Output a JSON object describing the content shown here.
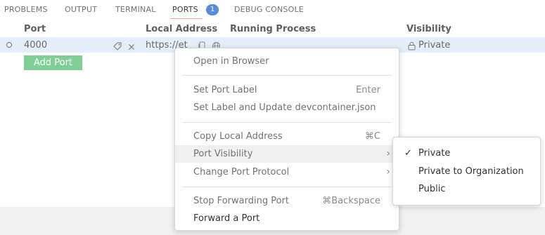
{
  "tabs": [
    {
      "label": "PROBLEMS"
    },
    {
      "label": "OUTPUT"
    },
    {
      "label": "TERMINAL"
    },
    {
      "label": "PORTS",
      "badge": "1"
    },
    {
      "label": "DEBUG CONSOLE"
    }
  ],
  "table": {
    "headers": [
      "Port",
      "Local Address",
      "Running Process",
      "Visibility"
    ],
    "row": {
      "port": "4000",
      "local_address": "https://et",
      "running_process": "",
      "visibility": "Private"
    },
    "add_port_label": "Add Port"
  },
  "context_menu": {
    "items": [
      {
        "label": "Open in Browser",
        "shortcut": ""
      },
      {
        "label": "Set Port Label",
        "shortcut": "Enter"
      },
      {
        "label": "Set Label and Update devcontainer.json",
        "shortcut": ""
      },
      {
        "label": "Copy Local Address",
        "shortcut": "⌘C"
      },
      {
        "label": "Port Visibility",
        "shortcut": "",
        "submenu": true
      },
      {
        "label": "Change Port Protocol",
        "shortcut": "",
        "submenu": true
      },
      {
        "label": "Stop Forwarding Port",
        "shortcut": "⌘Backspace"
      },
      {
        "label": "Forward a Port",
        "shortcut": ""
      }
    ]
  },
  "visibility_submenu": {
    "items": [
      {
        "label": "Private",
        "checked": true
      },
      {
        "label": "Private to Organization",
        "checked": false
      },
      {
        "label": "Public",
        "checked": false
      }
    ],
    "check_glyph": "✓"
  },
  "icons": {
    "label_edit": "tag-icon",
    "remove": "close-icon",
    "copy": "copy-icon",
    "browser": "globe-icon",
    "lock": "lock-icon",
    "submenu_arrow": "chevron-right-icon"
  },
  "colors": {
    "badge": "#5a8bd6",
    "selected_row": "#e4eef8",
    "add_button": "#7fcf95",
    "active_tab_underline": "#e8a29a"
  }
}
